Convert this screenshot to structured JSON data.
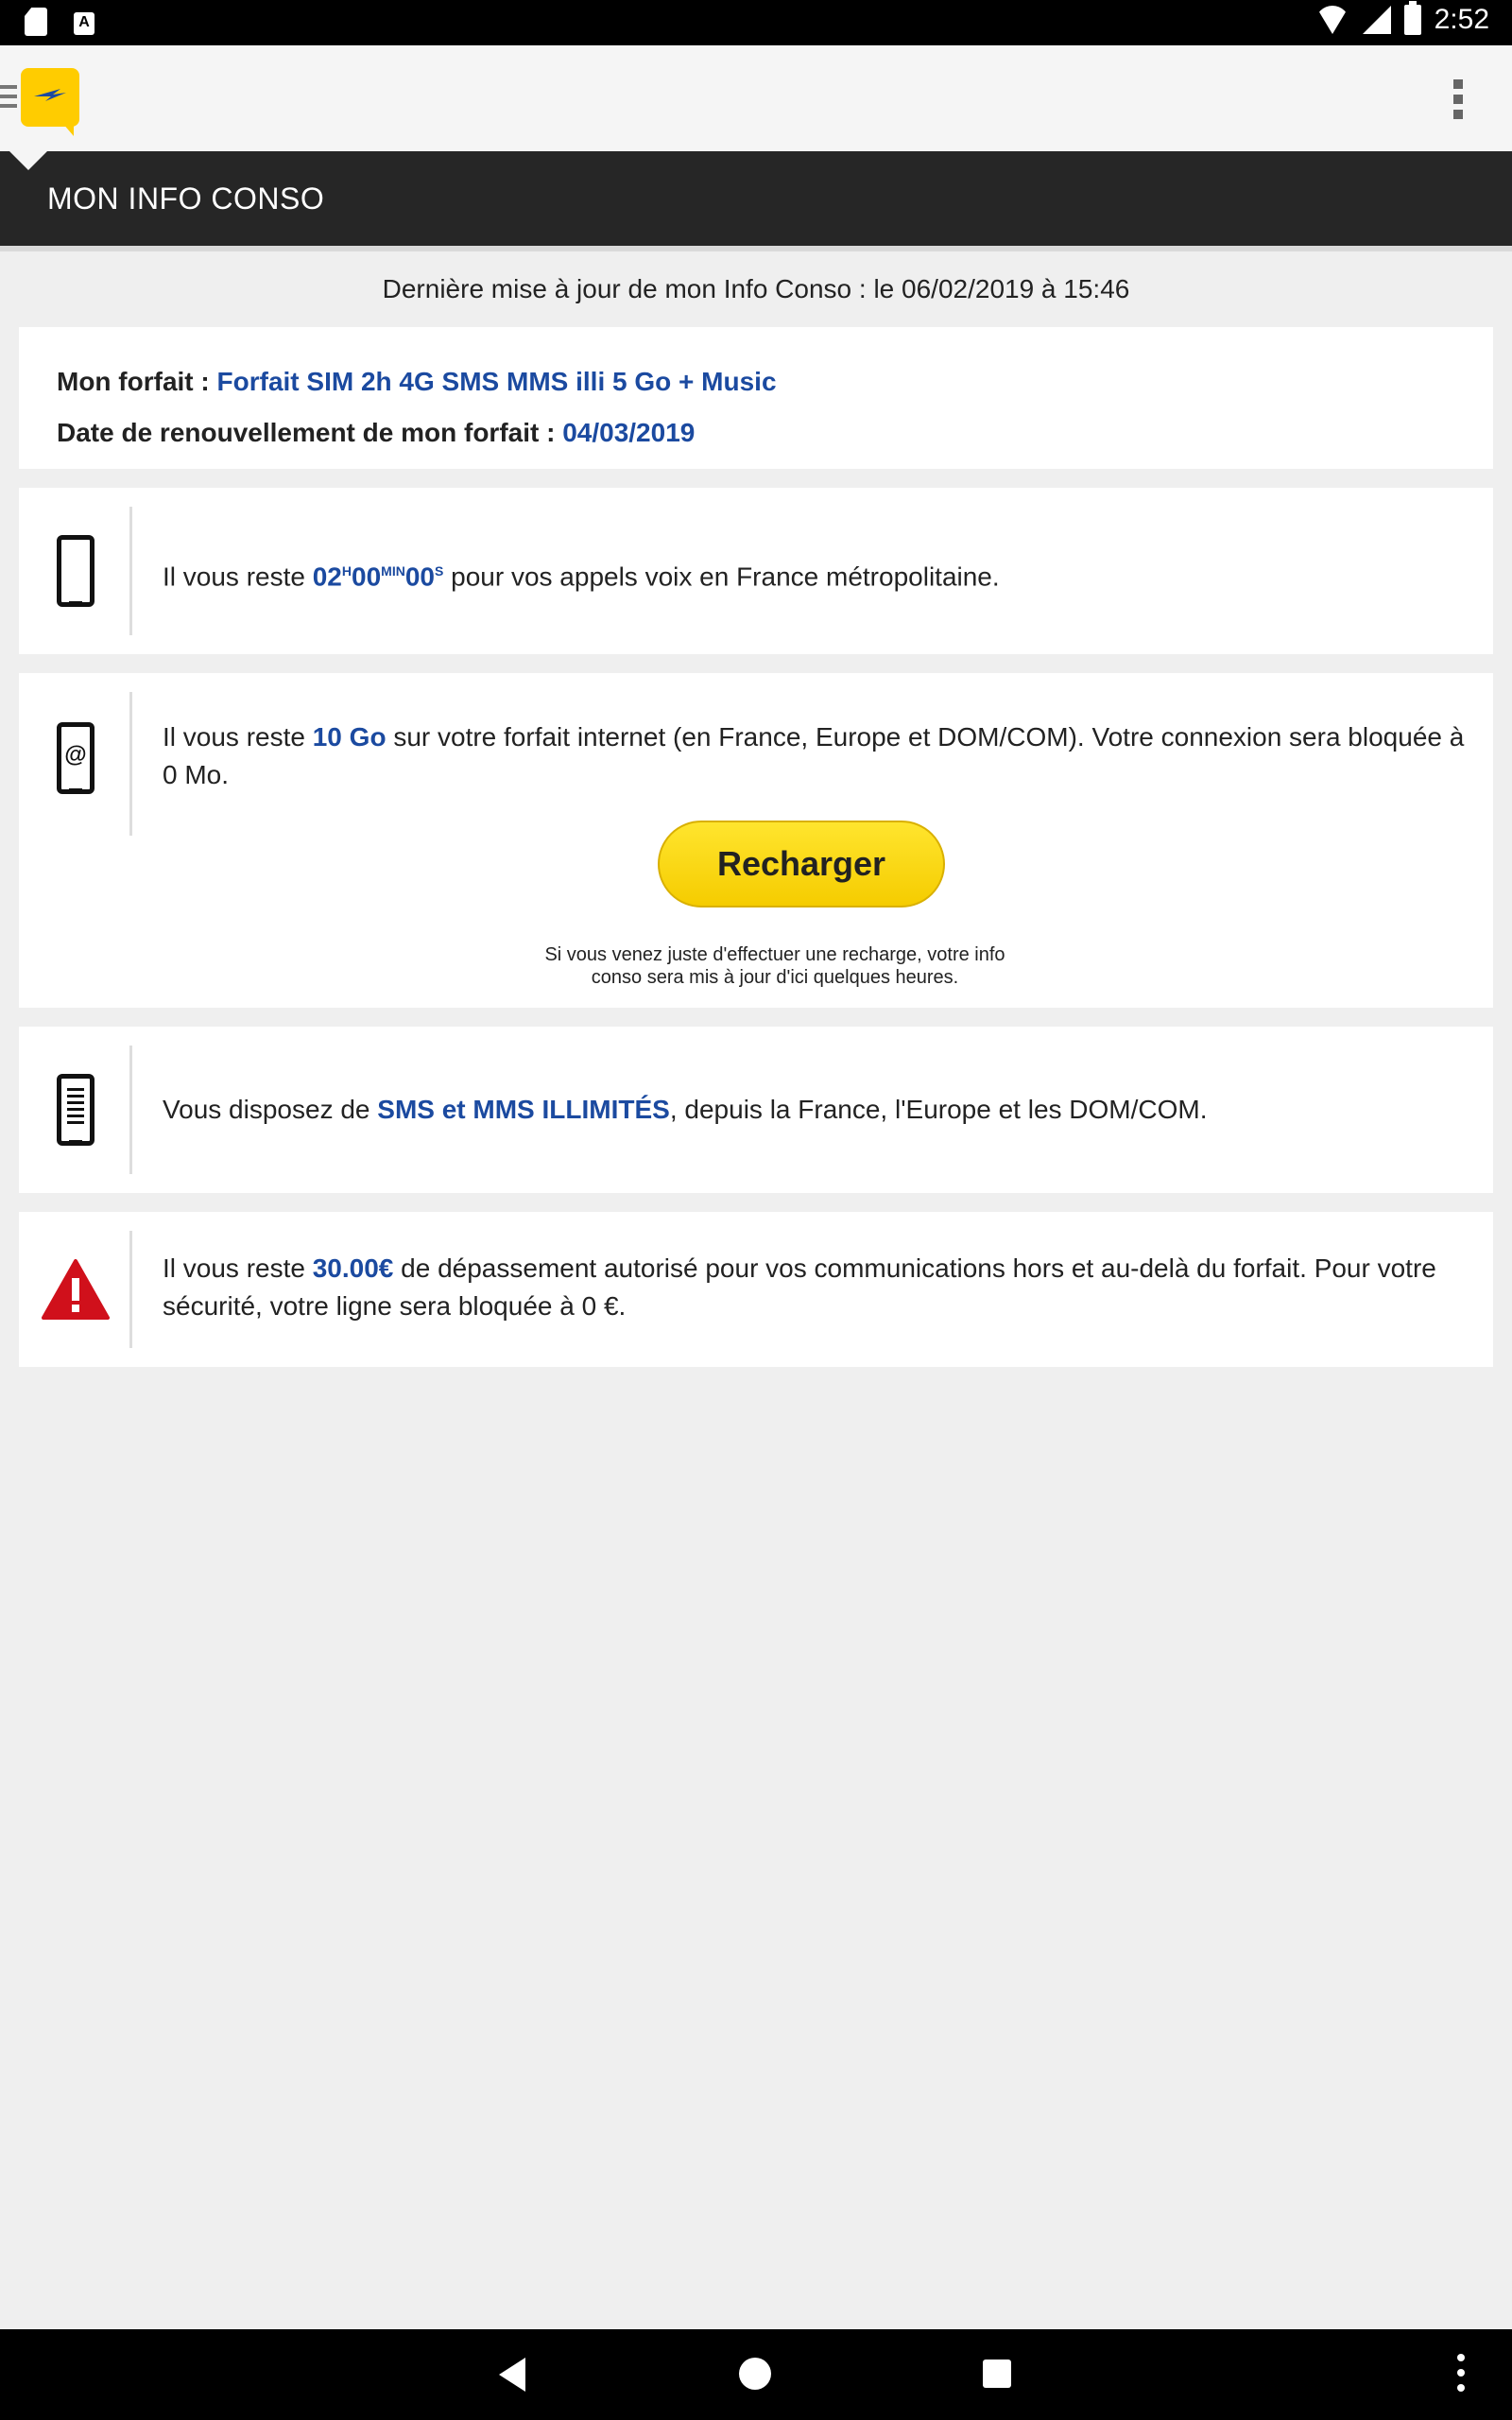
{
  "status_bar": {
    "clock": "2:52",
    "notification_icons": [
      "sd-card-icon",
      "text-icon"
    ],
    "text_icon_label": "A"
  },
  "app_bar": {
    "logo_icon": "la-poste-logo"
  },
  "page": {
    "title": "MON INFO CONSO",
    "updated_text": "Dernière mise à jour de mon Info Conso : le 06/02/2019 à 15:46"
  },
  "plan": {
    "label": "Mon forfait : ",
    "value": "Forfait SIM 2h 4G SMS MMS illi 5 Go + Music",
    "renewal_label": "Date de renouvellement de mon forfait : ",
    "renewal_value": "04/03/2019"
  },
  "voice": {
    "icon": "mobile-phone-icon",
    "prefix": "Il vous reste ",
    "hours": "02",
    "hours_unit": "H",
    "minutes": "00",
    "minutes_unit": "MIN",
    "seconds": "00",
    "seconds_unit": "S",
    "suffix": " pour vos appels voix en France métropolitaine."
  },
  "data": {
    "icon": "mobile-internet-icon",
    "at_symbol": "@",
    "prefix": "Il vous reste ",
    "amount": "10 Go",
    "suffix": " sur votre forfait internet (en France, Europe et DOM/COM). Votre connexion sera bloquée à 0 Mo.",
    "button_label": "Recharger",
    "note": "Si vous venez juste d'effectuer une recharge, votre info conso sera mis à jour d'ici quelques heures."
  },
  "sms": {
    "icon": "mobile-sms-icon",
    "prefix": "Vous disposez de ",
    "highlight": "SMS et MMS ILLIMITÉS",
    "suffix": ", depuis la France, l'Europe et les DOM/COM."
  },
  "alert": {
    "icon": "warning-icon",
    "prefix": "Il vous reste ",
    "amount": "30.00€",
    "suffix": " de dépassement autorisé pour vos communications hors et au-delà du forfait. Pour votre sécurité, votre ligne sera bloquée à 0 €."
  },
  "colors": {
    "accent_blue": "#1b4aa0",
    "brand_yellow": "#ffcc00",
    "title_bar": "#262626",
    "alert_red": "#d0101b"
  }
}
